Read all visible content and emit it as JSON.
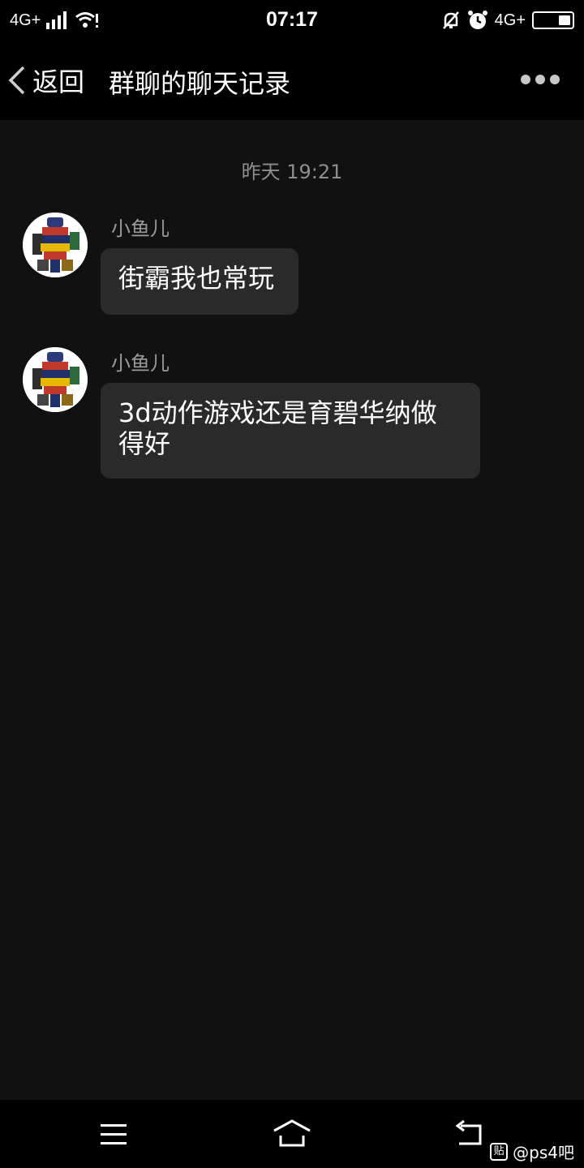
{
  "status_bar": {
    "network_left": "4G+",
    "time": "07:17",
    "network_right": "4G+",
    "icons": [
      "signal-icon",
      "wifi-icon",
      "mute-icon",
      "alarm-icon",
      "battery-icon"
    ]
  },
  "header": {
    "back_label": "返回",
    "title": "群聊的聊天记录"
  },
  "chat": {
    "timestamp": "昨天 19:21",
    "messages": [
      {
        "sender": "小鱼儿",
        "text": "街霸我也常玩"
      },
      {
        "sender": "小鱼儿",
        "text": "3d动作游戏还是育碧华纳做得好"
      }
    ]
  },
  "watermark": {
    "badge": "贴",
    "text": "@ps4吧"
  },
  "colors": {
    "background": "#111111",
    "bar": "#000000",
    "bubble": "#2a2a2a",
    "muted_text": "#8e8e8e"
  }
}
